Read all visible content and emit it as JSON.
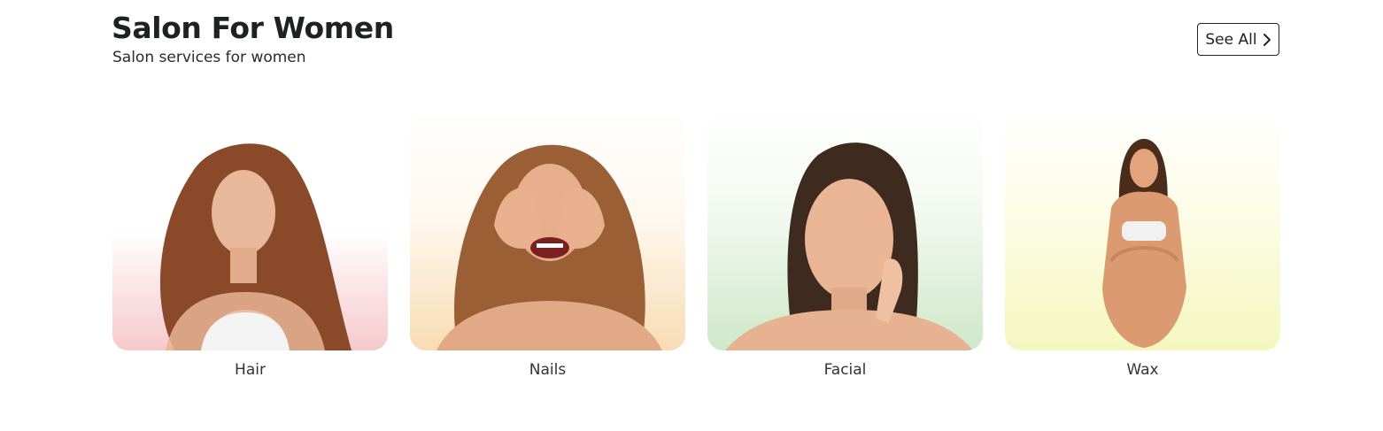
{
  "header": {
    "title": "Salon For Women",
    "subtitle": "Salon services for women",
    "see_all_label": "See All"
  },
  "categories": [
    {
      "label": "Hair",
      "tint": "#f6c9cc",
      "icon": "woman-long-hair-portrait"
    },
    {
      "label": "Nails",
      "tint": "#f8dcb4",
      "icon": "woman-covering-eyes-portrait"
    },
    {
      "label": "Facial",
      "tint": "#cfe8c8",
      "icon": "woman-face-portrait"
    },
    {
      "label": "Wax",
      "tint": "#f5f7c0",
      "icon": "woman-seated-portrait"
    }
  ]
}
